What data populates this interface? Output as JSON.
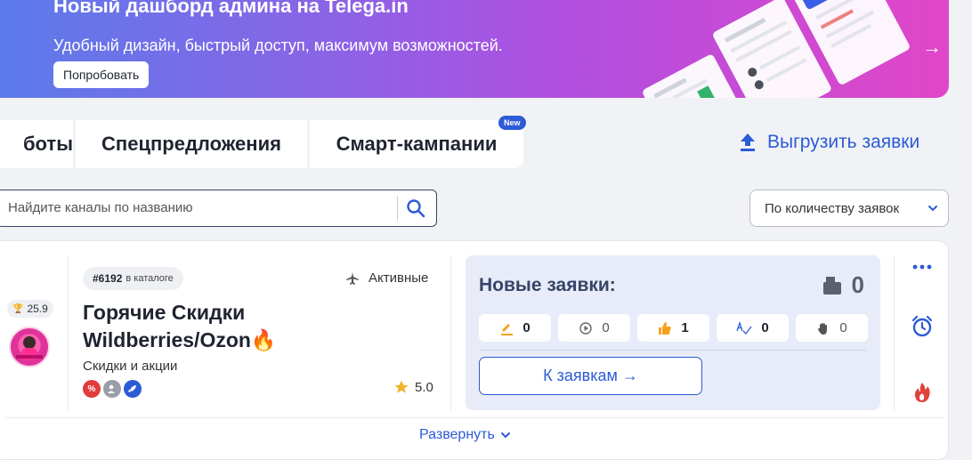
{
  "banner": {
    "title": "Новый дашборд админа на Telega.in",
    "subtitle": "Удобный дизайн, быстрый доступ, максимум возможностей.",
    "button_label": "Попробовать",
    "arrow": "→"
  },
  "tabs": [
    {
      "label": "боты"
    },
    {
      "label": "Спецпредложения"
    },
    {
      "label": "Смарт-кампании",
      "badge": "New"
    }
  ],
  "export_label": "Выгрузить заявки",
  "search": {
    "placeholder": "Найдите каналы по названию",
    "value": ""
  },
  "sort": {
    "selected": "По количеству заявок"
  },
  "channel": {
    "rank": "25.9",
    "catalog_id": "#6192",
    "catalog_text": "в каталоге",
    "status": "Активные",
    "title": "Горячие Скидки Wildberries/Ozon🔥",
    "category": "Скидки и акции",
    "rating": "5.0",
    "tags": [
      {
        "icon": "percent-icon",
        "color": "#e03c3c"
      },
      {
        "icon": "user-check-icon",
        "color": "#9a9ea8"
      },
      {
        "icon": "rocket-icon",
        "color": "#2c5bd6"
      }
    ]
  },
  "requests": {
    "title": "Новые заявки:",
    "total": "0",
    "stats": [
      {
        "icon": "pencil-icon",
        "value": "0"
      },
      {
        "icon": "play-circle-icon",
        "value": "0"
      },
      {
        "icon": "thumbs-up-icon",
        "value": "1"
      },
      {
        "icon": "spellcheck-icon",
        "value": "0"
      },
      {
        "icon": "hand-icon",
        "value": "0"
      }
    ],
    "button_label": "К заявкам →"
  },
  "expand_label": "Развернуть",
  "colors": {
    "accent": "#2c5bd6",
    "panel": "#e7ecf8",
    "dark": "#374468"
  }
}
